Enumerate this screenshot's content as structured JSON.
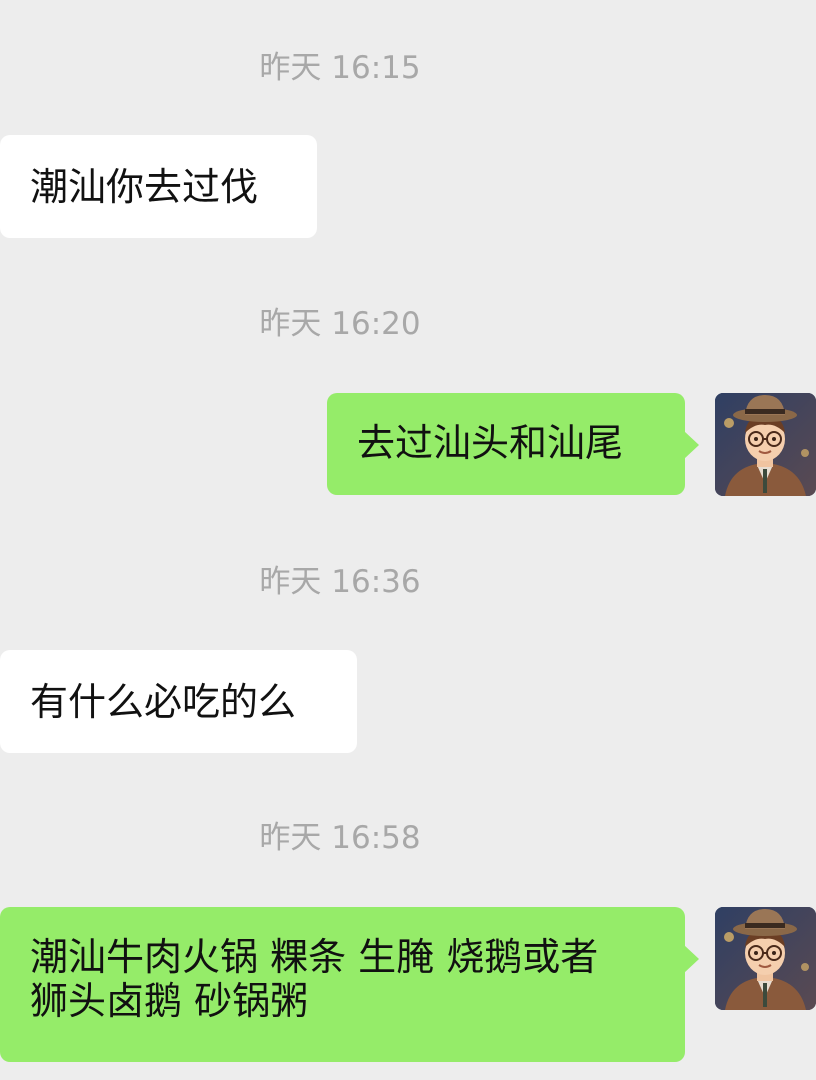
{
  "messages": [
    {
      "type": "timestamp",
      "text": "昨天 16:15"
    },
    {
      "type": "received",
      "text": "潮汕你去过伐"
    },
    {
      "type": "timestamp",
      "text": "昨天 16:20"
    },
    {
      "type": "sent",
      "text": "去过汕头和汕尾"
    },
    {
      "type": "timestamp",
      "text": "昨天 16:36"
    },
    {
      "type": "received",
      "text": "有什么必吃的么"
    },
    {
      "type": "timestamp",
      "text": "昨天 16:58"
    },
    {
      "type": "sent",
      "lines": [
        "潮汕牛肉火锅 粿条 生腌 烧鹅或者",
        "狮头卤鹅 砂锅粥"
      ]
    }
  ],
  "colors": {
    "background": "#ededed",
    "received_bubble": "#ffffff",
    "sent_bubble": "#95ec69",
    "timestamp_text": "#a8a8a8"
  },
  "avatar_icon": "cartoon-boy-with-hat-avatar"
}
